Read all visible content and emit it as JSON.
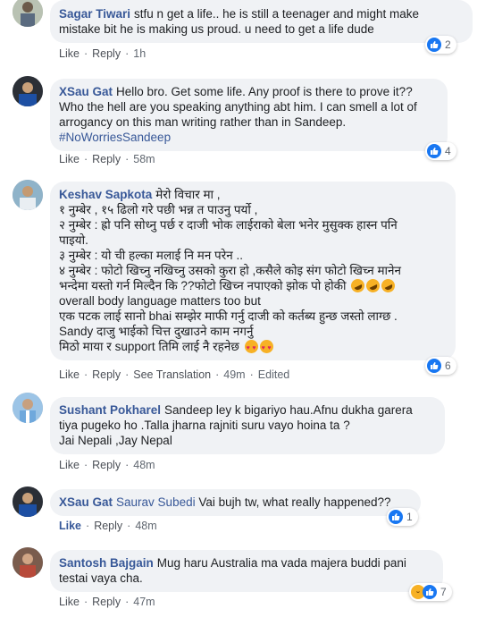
{
  "colors": {
    "link": "#385898",
    "bubble": "#f0f2f5",
    "like_blue": "#1877f2"
  },
  "comments": [
    {
      "author": "Sagar Tiwari",
      "lines": [
        "stfu n get a life.. he is still a teenager and might make",
        "mistake bit he is making us proud. u need to get a life dude"
      ],
      "actions": {
        "like": "Like",
        "reply": "Reply",
        "time": "1h"
      },
      "reaction_count": "2"
    },
    {
      "author": "XSau Gat",
      "lines": [
        "Hello bro. Get some life. Any proof is there to prove it??",
        "Who the hell are you speaking anything abt him. I can smell a lot of",
        "arrogancy on this man writing rather than in Sandeep."
      ],
      "hashtag": "#NoWorriesSandeep",
      "actions": {
        "like": "Like",
        "reply": "Reply",
        "time": "58m"
      },
      "reaction_count": "4"
    },
    {
      "author": "Keshav Sapkota",
      "lines": [
        "मेरो विचार मा ,",
        "१ नुम्बेर , १५ ढिलो गरे पछी भन्न त पाउनु पर्यो ,",
        "२ नुम्बेर : ह्रो पनि सोध्नु पर्छ र दाजी भोक लाईराको बेला भनेर मुसुक्क हास्न पनि",
        "पाइयो.",
        "३ नुम्बेर : यो ची हल्का मलाई नि मन परेन ..",
        "४ नुम्बेर : फोटो खिच्नु नखिच्नु उसको कुरा हो ,कसैले कोइ संग फोटो खिच्न मानेन",
        "भन्देमा यस्तो गर्न मिल्दैन कि ??फोटो खिच्न नपाएको झोक पो होकी",
        "overall body language matters too but",
        "एक पटक लाई सानो bhai सम्झेर माफी गर्नु दाजी को कर्तब्य हुन्छ जस्तो लाग्छ .",
        "Sandy दाजु भाईको चित्त दुखाउने काम नगर्नु",
        "मिठो माया र support तिमि लाई नै रहनेछ"
      ],
      "actions": {
        "like": "Like",
        "reply": "Reply",
        "see_translation": "See Translation",
        "time": "49m",
        "edited": "Edited"
      },
      "reaction_count": "6"
    },
    {
      "author": "Sushant Pokharel",
      "lines": [
        "Sandeep ley k bigariyo hau.Afnu dukha garera",
        "tiya pugeko ho .Talla jharna rajniti suru vayo hoina ta ?",
        "Jai Nepali ,Jay Nepal"
      ],
      "actions": {
        "like": "Like",
        "reply": "Reply",
        "time": "48m"
      }
    },
    {
      "author": "XSau Gat",
      "mention": "Saurav Subedi",
      "lines": [
        "Vai bujh tw, what really happened??"
      ],
      "actions": {
        "like": "Like",
        "reply": "Reply",
        "time": "48m"
      },
      "reaction_count": "1"
    },
    {
      "author": "Santosh Bajgain",
      "lines": [
        "Mug haru Australia ma vada majera buddi pani",
        "testai vaya cha."
      ],
      "actions": {
        "like": "Like",
        "reply": "Reply",
        "time": "47m"
      },
      "reaction_count": "7"
    }
  ]
}
